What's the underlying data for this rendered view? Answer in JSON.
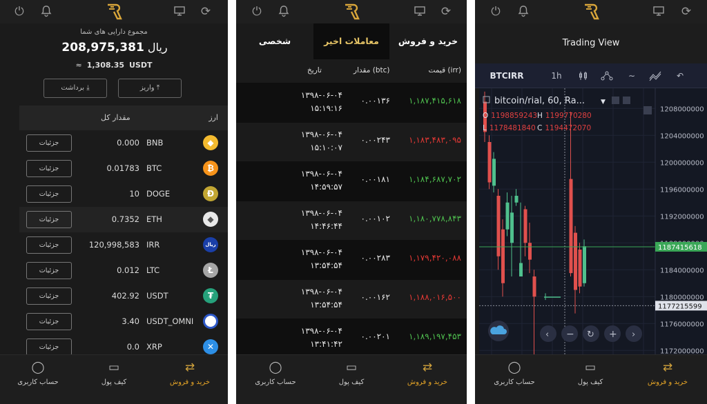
{
  "nav": {
    "profile": "حساب کاربری",
    "wallet": "کیف پول",
    "trade": "خرید و فروش"
  },
  "colors": {
    "accent": "#e6a526",
    "up": "#4fc04f",
    "down": "#e53935"
  },
  "icons": [
    "power-icon",
    "bell-icon",
    "logo-r",
    "monitor-icon",
    "refresh-icon",
    "user-icon",
    "wallet-icon",
    "exchange-icon"
  ],
  "wallet": {
    "title": "مجموع دارایی های شما",
    "rial_amount": "208,975,381",
    "rial_unit": "ریال",
    "usdt_approx": "≈",
    "usdt_amount": "1,308.35",
    "usdt_unit": "USDT",
    "withdraw": "برداشت",
    "deposit": "واریز",
    "col_total": "مقدار کل",
    "col_currency": "ارز",
    "details": "جزئیات",
    "rows": [
      {
        "amount": "0.000",
        "symbol": "BNB",
        "glyph": "◆",
        "color": "#f3ba2f"
      },
      {
        "amount": "0.01783",
        "symbol": "BTC",
        "glyph": "₿",
        "color": "#f7931a"
      },
      {
        "amount": "10",
        "symbol": "DOGE",
        "glyph": "Ð",
        "color": "#c2a633"
      },
      {
        "amount": "0.7352",
        "symbol": "ETH",
        "glyph": "◆",
        "color": "#e8e8e8"
      },
      {
        "amount": "120,998,583",
        "symbol": "IRR",
        "glyph": "ریال",
        "color": "#1a3fa8"
      },
      {
        "amount": "0.012",
        "symbol": "LTC",
        "glyph": "Ł",
        "color": "#a6a6a6"
      },
      {
        "amount": "402.92",
        "symbol": "USDT",
        "glyph": "₮",
        "color": "#26a17b"
      },
      {
        "amount": "3.40",
        "symbol": "USDT_OMNI",
        "glyph": "",
        "color": "#ffffff"
      },
      {
        "amount": "0.0",
        "symbol": "XRP",
        "glyph": "✕",
        "color": "#2d8fe6"
      }
    ]
  },
  "trades": {
    "tab_buysell": "خرید و فروش",
    "tab_recent": "معاملات اخیر",
    "tab_personal": "شخصی",
    "col_price": "قیمت (irr)",
    "col_amount": "مقدار (btc)",
    "col_date": "تاریخ",
    "rows": [
      {
        "price": "۱,۱۸۷,۴۱۵,۶۱۸",
        "dir": "up",
        "amount": "۰.۰۰۱۳۶",
        "date": "۱۳۹۸-۰۶-۰۴",
        "time": "۱۵:۱۹:۱۶"
      },
      {
        "price": "۱,۱۸۳,۴۸۳,۰۹۵",
        "dir": "dn",
        "amount": "۰.۰۰۲۴۳",
        "date": "۱۳۹۸-۰۶-۰۴",
        "time": "۱۵:۱۰:۰۷"
      },
      {
        "price": "۱,۱۸۴,۶۸۷,۷۰۲",
        "dir": "up",
        "amount": "۰.۰۰۱۸۱",
        "date": "۱۳۹۸-۰۶-۰۴",
        "time": "۱۴:۵۹:۵۷"
      },
      {
        "price": "۱,۱۸۰,۷۷۸,۸۴۳",
        "dir": "up",
        "amount": "۰.۰۰۱۰۲",
        "date": "۱۳۹۸-۰۶-۰۴",
        "time": "۱۴:۴۶:۴۴"
      },
      {
        "price": "۱,۱۷۹,۴۲۰,۰۸۸",
        "dir": "dn",
        "amount": "۰.۰۰۲۸۳",
        "date": "۱۳۹۸-۰۶-۰۴",
        "time": "۱۳:۵۴:۵۴"
      },
      {
        "price": "۱,۱۸۸,۰۱۶,۵۰۰",
        "dir": "dn",
        "amount": "۰.۰۰۱۶۲",
        "date": "۱۳۹۸-۰۶-۰۴",
        "time": "۱۳:۵۴:۵۴"
      },
      {
        "price": "۱,۱۸۹,۱۹۷,۴۵۳",
        "dir": "up",
        "amount": "۰.۰۰۲۰۱",
        "date": "۱۳۹۸-۰۶-۰۴",
        "time": "۱۳:۴۱:۴۲"
      }
    ]
  },
  "tv": {
    "title": "Trading View",
    "symbol": "BTCIRR",
    "interval": "1h",
    "legend": "bitcoin/rial, 60, Ra...",
    "o_label": "O",
    "o": "1198859243",
    "h_label": "H",
    "h": "1199770280",
    "l_label": "L",
    "l": "1178481840",
    "c_label": "C",
    "c": "1194472070",
    "price_tag_current": "1187415618",
    "price_tag_cross": "1177215599"
  },
  "chart_data": {
    "type": "candlestick",
    "y_ticks": [
      1208000000,
      1204000000,
      1200000000,
      1196000000,
      1192000000,
      1188000000,
      1184000000,
      1180000000,
      1176000000,
      1172000000
    ],
    "ylim": [
      1171000000,
      1211000000
    ],
    "candles": [
      {
        "o": 1209000000,
        "h": 1210500000,
        "l": 1203000000,
        "c": 1204500000
      },
      {
        "o": 1203000000,
        "h": 1204000000,
        "l": 1196000000,
        "c": 1197000000
      },
      {
        "o": 1196500000,
        "h": 1201500000,
        "l": 1195500000,
        "c": 1200500000
      },
      {
        "o": 1195000000,
        "h": 1196000000,
        "l": 1184000000,
        "c": 1186000000
      },
      {
        "o": 1190000000,
        "h": 1191500000,
        "l": 1180000000,
        "c": 1182000000
      },
      {
        "o": 1190000000,
        "h": 1195500000,
        "l": 1189000000,
        "c": 1194000000
      },
      {
        "o": 1188000000,
        "h": 1195000000,
        "l": 1183000000,
        "c": 1192500000
      },
      {
        "o": 1194000000,
        "h": 1196000000,
        "l": 1193500000,
        "c": 1195000000
      },
      {
        "o": 1183000000,
        "h": 1194000000,
        "l": 1183000000,
        "c": 1185000000
      },
      {
        "o": 1193000000,
        "h": 1193500000,
        "l": 1186000000,
        "c": 1188000000
      },
      {
        "o": 1188000000,
        "h": 1191000000,
        "l": 1183500000,
        "c": 1185500000
      },
      {
        "o": 1183000000,
        "h": 1184000000,
        "l": 1170500000,
        "c": 1180000000
      },
      {
        "o": 1180000000,
        "h": 1180500000,
        "l": 1179500000,
        "c": 1180000000
      },
      {
        "o": 1197500000,
        "h": 1207500000,
        "l": 1183000000,
        "c": 1183500000
      },
      {
        "o": 1189500000,
        "h": 1190500000,
        "l": 1177500000,
        "c": 1181000000
      },
      {
        "o": 1187000000,
        "h": 1188000000,
        "l": 1180500000,
        "c": 1181500000
      },
      {
        "o": 1182000000,
        "h": 1188500000,
        "l": 1181500000,
        "c": 1187500000
      }
    ],
    "current_price": 1187415618,
    "crosshair_price": 1177215599
  }
}
